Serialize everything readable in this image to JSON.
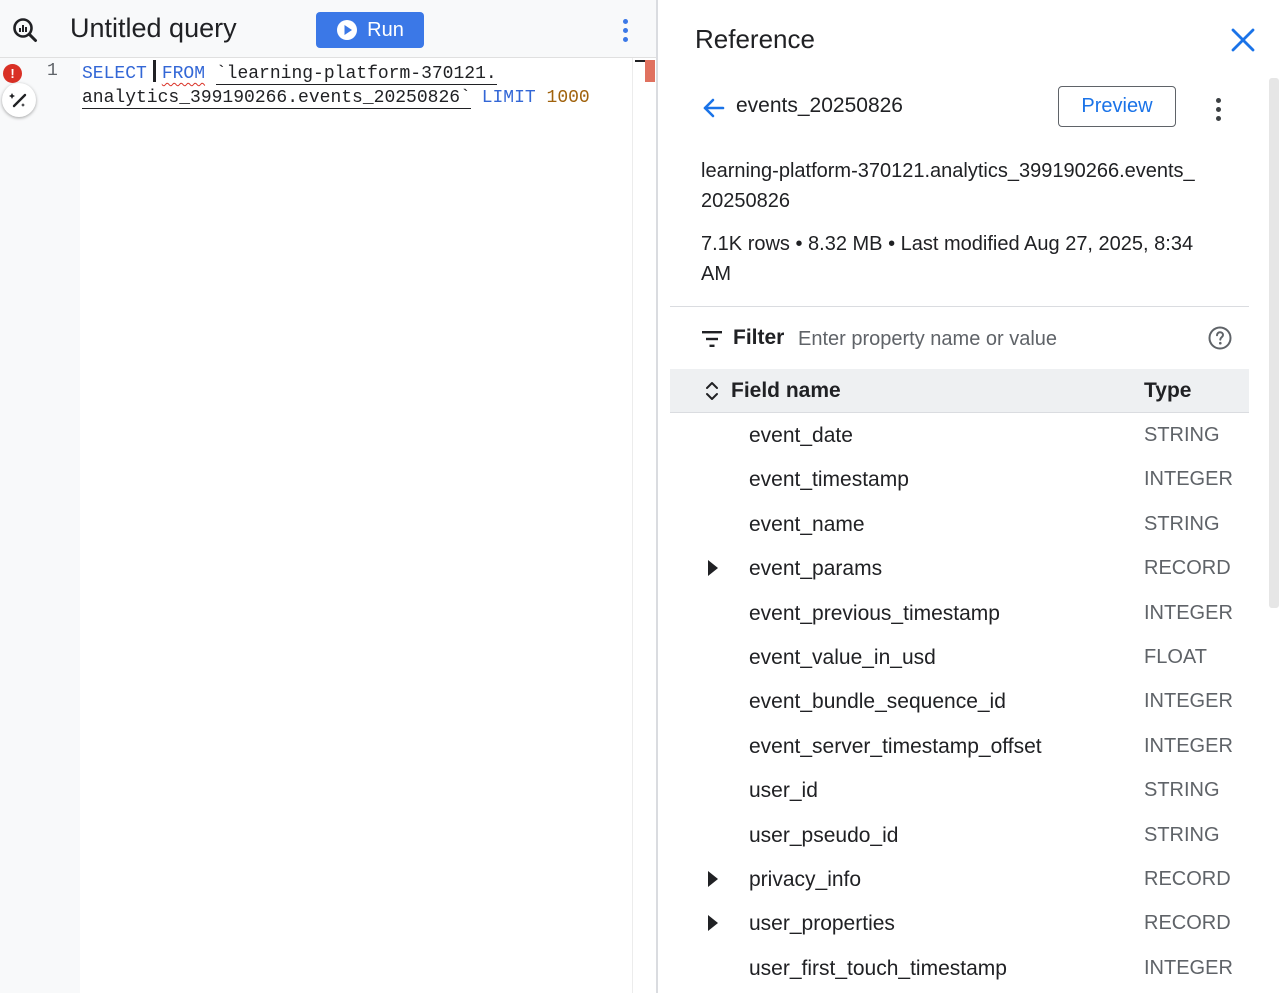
{
  "editor": {
    "title": "Untitled query",
    "run_label": "Run",
    "line_number": "1",
    "code": {
      "select_kw": "SELECT",
      "from_kw": "FROM",
      "table_ref_line1": "`learning-platform-370121.",
      "table_ref_line2": "analytics_399190266.events_20250826`",
      "limit_kw": "LIMIT",
      "limit_value": "1000"
    },
    "error_glyph": "!"
  },
  "reference": {
    "title": "Reference",
    "table_name": "events_20250826",
    "preview_label": "Preview",
    "full_path": "learning-platform-370121.analytics_399190266.events_20250826",
    "stats": "7.1K rows • 8.32 MB • Last modified Aug 27, 2025, 8:34 AM",
    "filter": {
      "label": "Filter",
      "placeholder": "Enter property name or value"
    },
    "schema": {
      "field_header": "Field name",
      "type_header": "Type",
      "fields": [
        {
          "name": "event_date",
          "type": "STRING",
          "expandable": false
        },
        {
          "name": "event_timestamp",
          "type": "INTEGER",
          "expandable": false
        },
        {
          "name": "event_name",
          "type": "STRING",
          "expandable": false
        },
        {
          "name": "event_params",
          "type": "RECORD",
          "expandable": true
        },
        {
          "name": "event_previous_timestamp",
          "type": "INTEGER",
          "expandable": false
        },
        {
          "name": "event_value_in_usd",
          "type": "FLOAT",
          "expandable": false
        },
        {
          "name": "event_bundle_sequence_id",
          "type": "INTEGER",
          "expandable": false
        },
        {
          "name": "event_server_timestamp_offset",
          "type": "INTEGER",
          "expandable": false
        },
        {
          "name": "user_id",
          "type": "STRING",
          "expandable": false
        },
        {
          "name": "user_pseudo_id",
          "type": "STRING",
          "expandable": false
        },
        {
          "name": "privacy_info",
          "type": "RECORD",
          "expandable": true
        },
        {
          "name": "user_properties",
          "type": "RECORD",
          "expandable": true
        },
        {
          "name": "user_first_touch_timestamp",
          "type": "INTEGER",
          "expandable": false
        }
      ]
    }
  },
  "icons": {
    "query": "query-search-icon",
    "run": "play-circle-icon",
    "editor_menu": "more-vert-icon",
    "error": "error-icon",
    "assist": "magic-pen-icon",
    "close": "close-icon",
    "back": "arrow-back-icon",
    "ref_menu": "more-vert-icon",
    "filter": "filter-list-icon",
    "help": "help-icon",
    "sort": "unfold-icon",
    "expand": "arrow-right-icon"
  },
  "colors": {
    "accent": "#1a73e8",
    "run_button": "#3b78e7",
    "keyword": "#3367d6",
    "number": "#a0620c",
    "error": "#d93025"
  }
}
